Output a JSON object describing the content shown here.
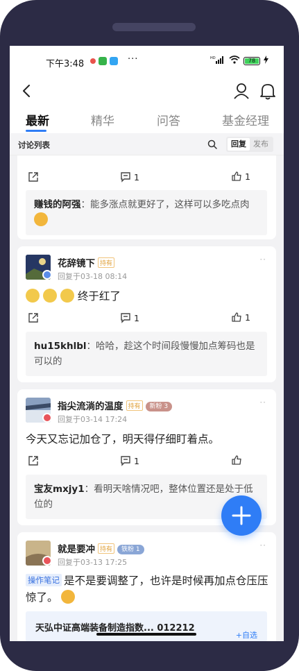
{
  "status": {
    "time": "下午3:48",
    "dots": "···",
    "battery": "78",
    "signal_label": "4G",
    "accent": "#2f7df6"
  },
  "tabs": [
    {
      "label": "最新",
      "active": true
    },
    {
      "label": "精华",
      "active": false
    },
    {
      "label": "问答",
      "active": false
    },
    {
      "label": "基金经理",
      "active": false
    }
  ],
  "subbar": {
    "title": "讨论列表",
    "seg_reply": "回复",
    "seg_post": "发布"
  },
  "posts": [
    {
      "comments": "1",
      "likes": "1",
      "reply_user": "赚钱的阿强",
      "reply_text": "能多涨点就更好了，这样可以多吃点肉"
    },
    {
      "user": "花辞镜下",
      "hold_tag": "持有",
      "time": "回复于03-18 08:14",
      "text": "终于红了",
      "comments": "1",
      "likes": "1",
      "reply_user": "hu15khlbl",
      "reply_text": "哈哈，趁这个时间段慢慢加点筹码也是可以的"
    },
    {
      "user": "指尖流淌的温度",
      "hold_tag": "持有",
      "fan_tag": "新粉 3",
      "time": "回复于03-14 17:24",
      "text": "今天又忘记加仓了，明天得仔细盯着点。",
      "comments": "1",
      "reply_user": "宝友mxjy1",
      "reply_text": "看明天啥情况吧，整体位置还是处于低位的"
    },
    {
      "user": "就是要冲",
      "hold_tag": "持有",
      "fan_tag": "铁粉 1",
      "time": "回复于03-13 17:25",
      "topic": "操作笔记",
      "text": "是不是要调整了，也许是时候再加点仓压压惊了。",
      "fund": "天弘中证高端装备制造指数... 012212",
      "fund_action": "+自选"
    }
  ]
}
